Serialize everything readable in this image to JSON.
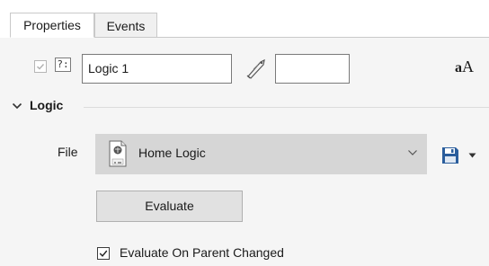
{
  "tabs": [
    {
      "label": "Properties",
      "active": true
    },
    {
      "label": "Events",
      "active": false
    }
  ],
  "name_row": {
    "enabled_checked": true,
    "type_icon_text": "?:",
    "name_value": "Logic 1",
    "tag_value": "",
    "font_icon_small": "a",
    "font_icon_big": "A"
  },
  "section": {
    "title": "Logic",
    "expanded": true
  },
  "file": {
    "label": "File",
    "selected": "Home Logic"
  },
  "evaluate": {
    "button_label": "Evaluate",
    "checkbox_label": "Evaluate On Parent Changed",
    "checkbox_checked": true
  },
  "icons": {
    "section_toggle": "chevron-down-icon",
    "tag": "tag-icon",
    "font": "font-size-icon",
    "file_doc": "logic-file-icon",
    "save": "save-icon",
    "save_menu": "caret-down-icon",
    "select_arrow": "chevron-down-icon"
  },
  "colors": {
    "panel_bg": "#f5f5f5",
    "select_bg": "#d6d6d6",
    "button_bg": "#e1e1e1",
    "save_icon": "#2a5d9c"
  }
}
